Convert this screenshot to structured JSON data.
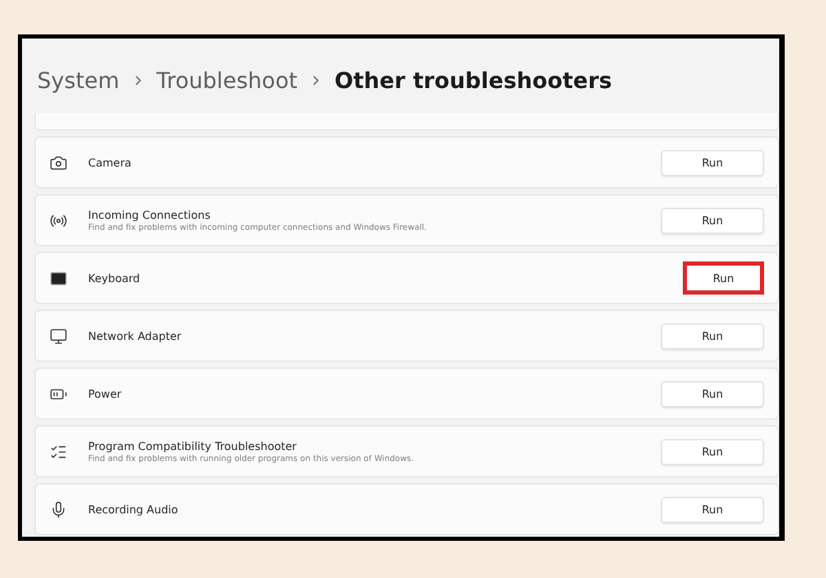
{
  "breadcrumb": [
    {
      "label": "System",
      "current": false
    },
    {
      "label": "Troubleshoot",
      "current": false
    },
    {
      "label": "Other troubleshooters",
      "current": true
    }
  ],
  "troubleshooters": [
    {
      "title": "Camera",
      "button": "Run",
      "highlighted": false
    },
    {
      "title": "Incoming Connections",
      "description": "Find and fix problems with incoming computer connections and Windows Firewall.",
      "button": "Run",
      "highlighted": false
    },
    {
      "title": "Keyboard",
      "button": "Run",
      "highlighted": true
    },
    {
      "title": "Network Adapter",
      "button": "Run",
      "highlighted": false
    },
    {
      "title": "Power",
      "button": "Run",
      "highlighted": false
    },
    {
      "title": "Program Compatibility Troubleshooter",
      "description": "Find and fix problems with running older programs on this version of Windows.",
      "button": "Run",
      "highlighted": false
    },
    {
      "title": "Recording Audio",
      "button": "Run",
      "highlighted": false
    }
  ]
}
